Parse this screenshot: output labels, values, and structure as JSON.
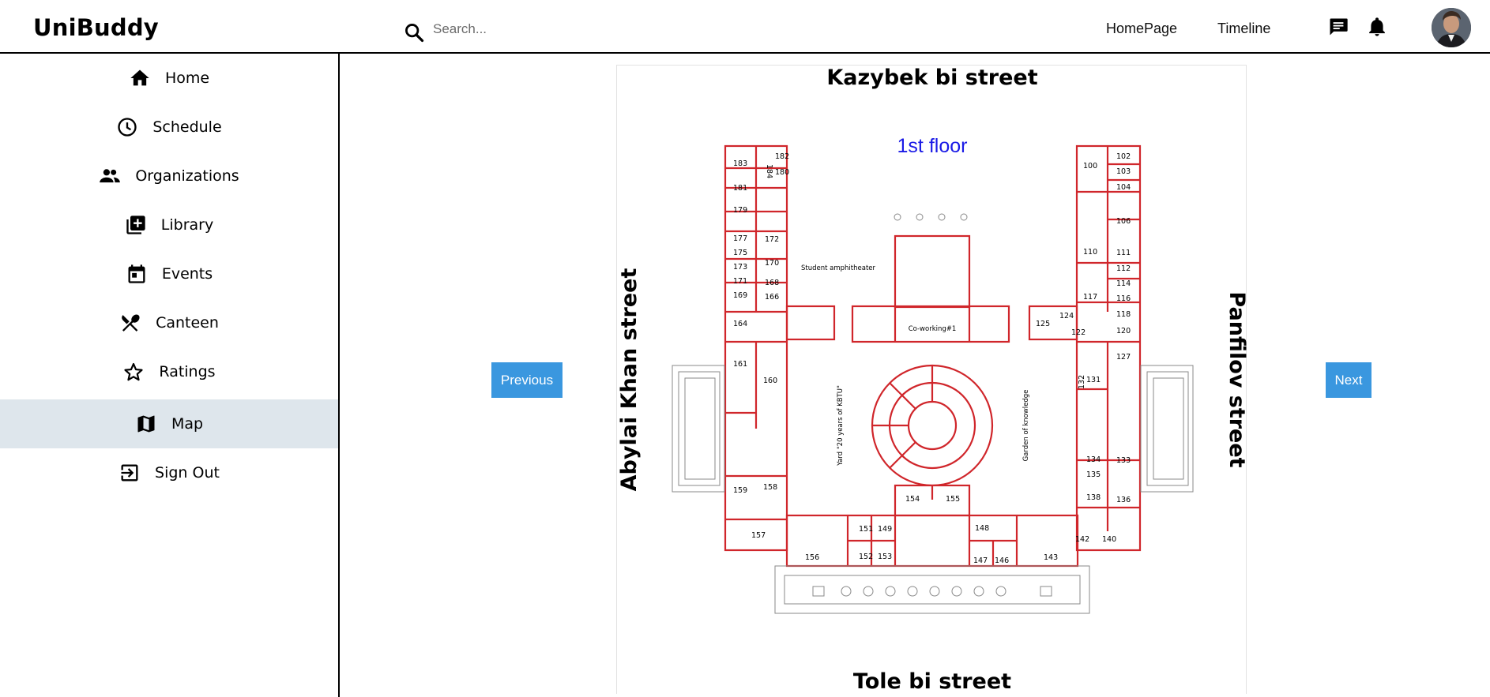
{
  "app": {
    "brand": "UniBuddy"
  },
  "header": {
    "search_placeholder": "Search...",
    "nav": [
      {
        "label": "HomePage"
      },
      {
        "label": "Timeline"
      }
    ],
    "icons": [
      "search-icon",
      "chat-icon",
      "bell-icon",
      "avatar"
    ]
  },
  "sidebar": {
    "items": [
      {
        "label": "Home",
        "icon": "home-icon"
      },
      {
        "label": "Schedule",
        "icon": "clock-icon"
      },
      {
        "label": "Organizations",
        "icon": "people-icon"
      },
      {
        "label": "Library",
        "icon": "library-add-icon"
      },
      {
        "label": "Events",
        "icon": "calendar-icon"
      },
      {
        "label": "Canteen",
        "icon": "fork-knife-icon"
      },
      {
        "label": "Ratings",
        "icon": "star-icon"
      },
      {
        "label": "Map",
        "icon": "map-icon",
        "active": true
      },
      {
        "label": "Sign Out",
        "icon": "sign-out-icon"
      }
    ]
  },
  "map": {
    "floor_title": "1st floor",
    "streets": {
      "top": "Kazybek bi street",
      "bottom": "Tole bi street",
      "left": "Abylai Khan street",
      "right": "Panfilov street"
    },
    "labels": {
      "amphitheater": "Student amphitheater",
      "coworking": "Co-working#1",
      "yard": "Yard \"20 years of KBTU\"",
      "garden": "Garden of knowledge"
    },
    "rooms_left": [
      "184",
      "182",
      "183",
      "180",
      "181",
      "179",
      "172",
      "177",
      "175",
      "170",
      "173",
      "168",
      "171",
      "166",
      "169",
      "164",
      "161",
      "160",
      "159",
      "158",
      "157",
      "156"
    ],
    "rooms_right": [
      "102",
      "100",
      "103",
      "104",
      "106",
      "110",
      "111",
      "112",
      "117",
      "114",
      "116",
      "124",
      "118",
      "125",
      "122",
      "120",
      "127",
      "131",
      "132",
      "134",
      "133",
      "135",
      "138",
      "136",
      "142",
      "140",
      "143"
    ],
    "rooms_center": [
      "154",
      "155",
      "151",
      "149",
      "148",
      "152",
      "153",
      "147",
      "146"
    ]
  },
  "controls": {
    "previous_label": "Previous",
    "next_label": "Next"
  },
  "colors": {
    "accent": "#3a97df",
    "active_bg": "#dee6ec",
    "floor_title": "#1a1ae6",
    "walls": "#d0262b"
  }
}
